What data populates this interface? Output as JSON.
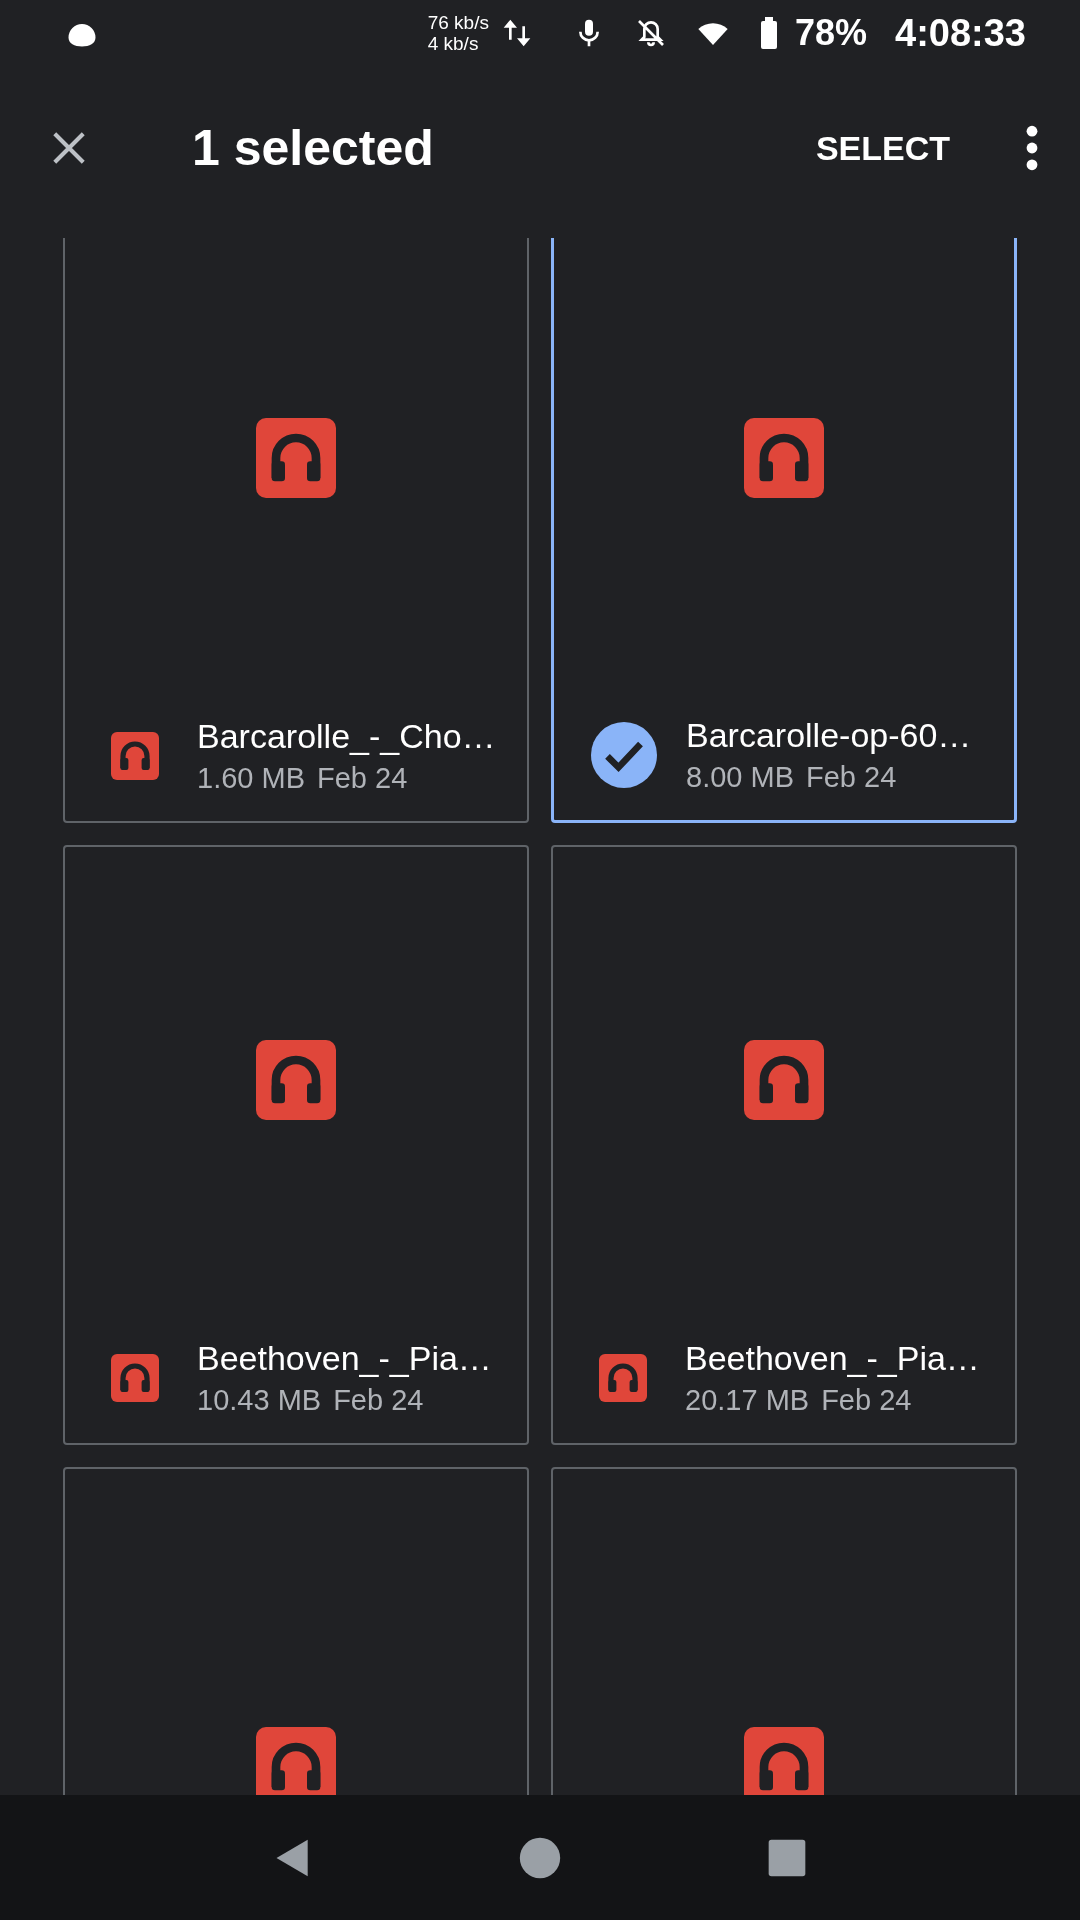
{
  "status_bar": {
    "upload_speed": "76 kb/s",
    "download_speed": "4 kb/s",
    "battery": "78%",
    "time": "4:08:33"
  },
  "toolbar": {
    "title": "1 selected",
    "action": "SELECT"
  },
  "cards": [
    {
      "name": "Barcarolle_-_Cho…",
      "size": "1.60 MB",
      "date": "Feb 24",
      "selected": false
    },
    {
      "name": "Barcarolle-op-60…",
      "size": "8.00 MB",
      "date": "Feb 24",
      "selected": true
    },
    {
      "name": "Beethoven_-_Pia…",
      "size": "10.43 MB",
      "date": "Feb 24",
      "selected": false
    },
    {
      "name": "Beethoven_-_Pia…",
      "size": "20.17 MB",
      "date": "Feb 24",
      "selected": false
    },
    {
      "selected": false
    },
    {
      "selected": false
    }
  ]
}
